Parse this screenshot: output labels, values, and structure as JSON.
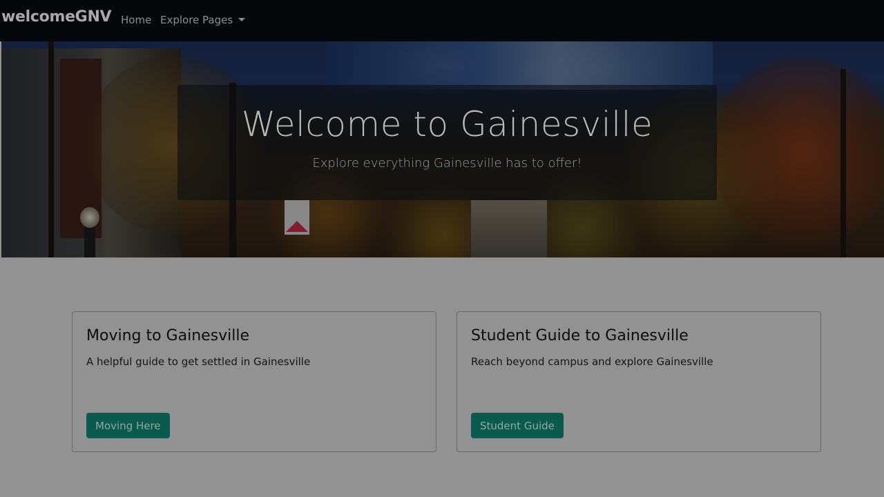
{
  "navbar": {
    "brand": "welcomeGNV",
    "links": [
      {
        "label": "Home"
      },
      {
        "label": "Explore Pages"
      }
    ]
  },
  "hero": {
    "title": "Welcome to Gainesville",
    "subtitle": "Explore everything Gainesville has to offer!"
  },
  "cards": [
    {
      "title": "Moving to Gainesville",
      "text": "A helpful guide to get settled in Gainesville",
      "button": "Moving Here"
    },
    {
      "title": "Student Guide to Gainesville",
      "text": "Reach beyond campus and explore Gainesville",
      "button": "Student Guide"
    }
  ],
  "colors": {
    "navbar_bg": "#05080a",
    "page_bg": "#929292",
    "button_bg": "#0b5a4e"
  }
}
